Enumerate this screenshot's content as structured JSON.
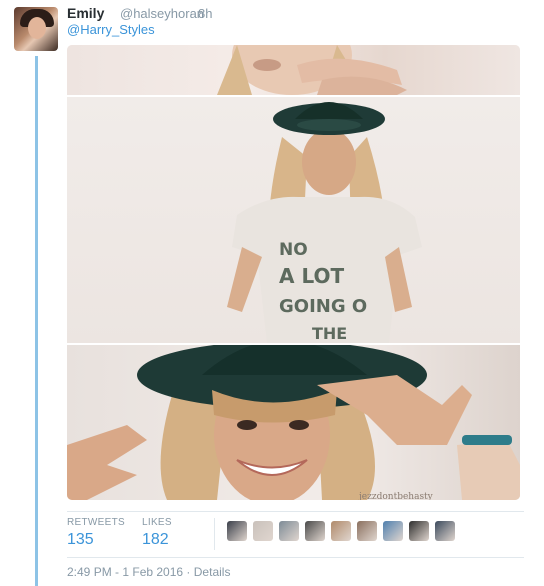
{
  "tweet": {
    "author_name": "Emily",
    "author_handle": "@halseyhoran",
    "separator": "·",
    "time_ago": "8h",
    "text_mention": "@Harry_Styles"
  },
  "media": {
    "shirt_lines": [
      "NO",
      "A LOT",
      "GOING O",
      "THE"
    ],
    "watermark": "jezzdontbehasty"
  },
  "stats": {
    "retweets_label": "RETWEETS",
    "retweets_count": "135",
    "likes_label": "LIKES",
    "likes_count": "182"
  },
  "likers": [
    {
      "name": "liker-1",
      "color": "#3a3f4a"
    },
    {
      "name": "liker-2",
      "color": "#c9c1bb"
    },
    {
      "name": "liker-3",
      "color": "#7d8b96"
    },
    {
      "name": "liker-4",
      "color": "#4a4a4a"
    },
    {
      "name": "liker-5",
      "color": "#b08a6a"
    },
    {
      "name": "liker-6",
      "color": "#8a6f5e"
    },
    {
      "name": "liker-7",
      "color": "#4f7fae"
    },
    {
      "name": "liker-8",
      "color": "#2e2e2e"
    },
    {
      "name": "liker-9",
      "color": "#3b4a5c"
    }
  ],
  "footer": {
    "timestamp": "2:49 PM - 1 Feb 2016",
    "separator": "·",
    "details_link": "Details"
  }
}
